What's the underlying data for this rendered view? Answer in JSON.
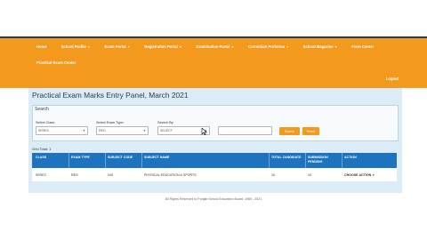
{
  "colors": {
    "nav_bg": "#f39a1e",
    "table_header": "#1e73be",
    "content_bg": "#dcecf6"
  },
  "navbar": {
    "row1": [
      {
        "label": "Home",
        "dropdown": false
      },
      {
        "label": "School Profile",
        "dropdown": true
      },
      {
        "label": "Exam Portal",
        "dropdown": true
      },
      {
        "label": "Registration Portal",
        "dropdown": true
      },
      {
        "label": "Examination Portal",
        "dropdown": true
      },
      {
        "label": "Correction Proforma",
        "dropdown": true
      },
      {
        "label": "School Magazine",
        "dropdown": true
      },
      {
        "label": "Form Center",
        "dropdown": false
      }
    ],
    "row2": [
      {
        "label": "Practical Exam Center",
        "dropdown": false
      }
    ],
    "logout": "Logout"
  },
  "page": {
    "title": "Practical Exam Marks Entry Panel, March 2021"
  },
  "search": {
    "title": "Search",
    "class_label": "Select Class:",
    "class_value": "SRSEC",
    "exam_type_label": "Select Exam Type:",
    "exam_type_value": "REG",
    "search_by_label": "Search By:",
    "search_by_value": "SELECT",
    "search_button": "Search",
    "reset_button": "Reset"
  },
  "table": {
    "grid_total": "Grid Total: 1",
    "headers": [
      "CLASS",
      "EXAM TYPE",
      "SUBJECT CODE",
      "SUBJECT NAME",
      "TOTAL CANDIDATE",
      "SUBMISSION PENDING",
      "ACTION"
    ],
    "rows": [
      [
        "SRSEC",
        "REG",
        "049",
        "PHYSICAL EDUCATION & SPORTS",
        "10",
        "10",
        "CHOOSE ACTION"
      ]
    ]
  },
  "footer": {
    "text": "All Rights Reserved to Punjab School Education Board, 1969 - 2021"
  }
}
